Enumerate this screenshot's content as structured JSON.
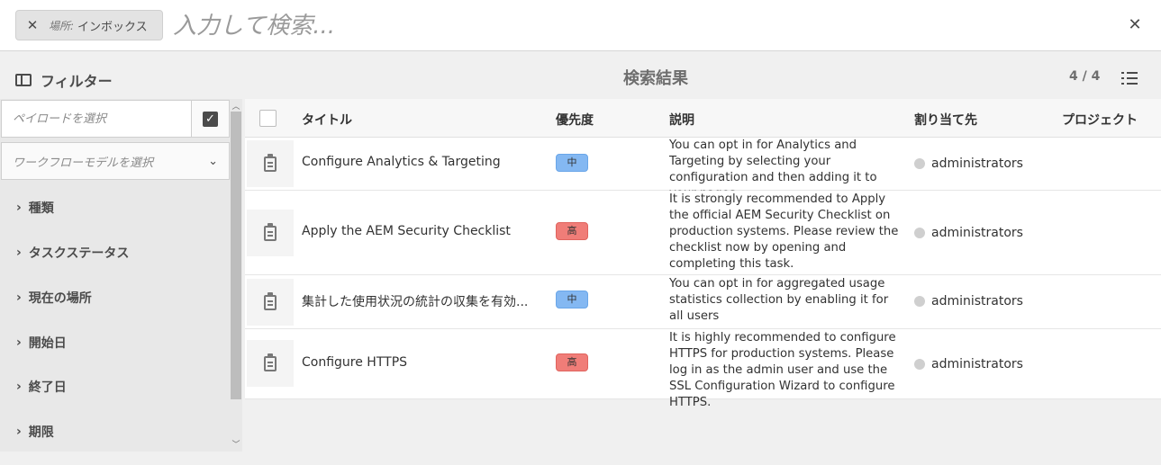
{
  "search": {
    "location_prefix": "場所:",
    "location_value": "インボックス",
    "placeholder": "入力して検索..."
  },
  "header": {
    "filter_label": "フィルター",
    "results_title": "検索結果",
    "results_count": "4 / 4"
  },
  "sidebar": {
    "payload_placeholder": "ペイロードを選択",
    "model_placeholder": "ワークフローモデルを選択",
    "facets": [
      "種類",
      "タスクステータス",
      "現在の場所",
      "開始日",
      "終了日",
      "期限"
    ]
  },
  "table": {
    "columns": [
      "タイトル",
      "優先度",
      "説明",
      "割り当て先",
      "プロジェクト"
    ],
    "rows": [
      {
        "title": "Configure Analytics & Targeting",
        "priority": "中",
        "priority_level": "medium",
        "description": "You can opt in for Analytics and Targeting by selecting your configuration and then adding it to your pages.",
        "assignee": "administrators",
        "project": ""
      },
      {
        "title": "Apply the AEM Security Checklist",
        "priority": "高",
        "priority_level": "high",
        "description": "It is strongly recommended to Apply the official AEM Security Checklist on production systems. Please review the checklist now by opening and completing this task.",
        "assignee": "administrators",
        "project": ""
      },
      {
        "title": "集計した使用状況の統計の収集を有効...",
        "priority": "中",
        "priority_level": "medium",
        "description": "You can opt in for aggregated usage statistics collection by enabling it for all users",
        "assignee": "administrators",
        "project": ""
      },
      {
        "title": "Configure HTTPS",
        "priority": "高",
        "priority_level": "high",
        "description": "It is highly recommended to configure HTTPS for production systems. Please log in as the admin user and use the SSL Configuration Wizard to configure HTTPS.",
        "assignee": "administrators",
        "project": ""
      }
    ]
  },
  "colors": {
    "priority_medium": "#84b8f2",
    "priority_high": "#f07d78"
  },
  "icons": {
    "row_icon": "clipboard-icon",
    "view_toggle": "list-view-icon",
    "filter_toggle": "rail-toggle-icon"
  }
}
